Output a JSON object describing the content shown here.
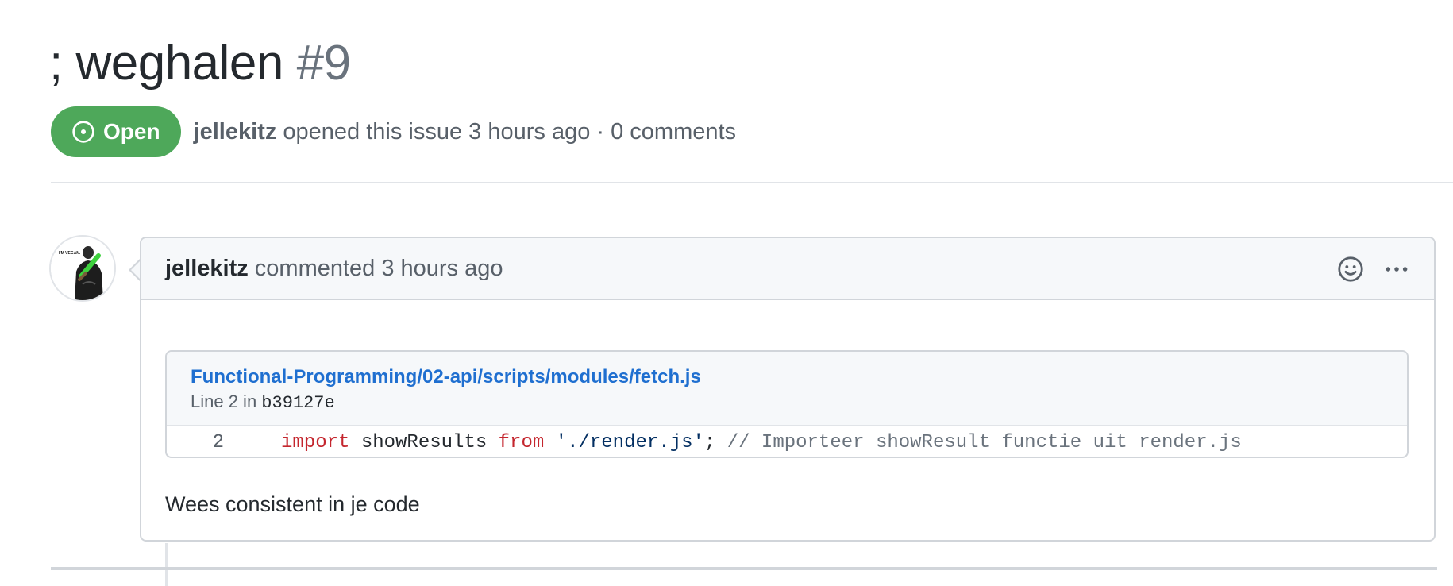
{
  "issue": {
    "title": "; weghalen",
    "number": "#9",
    "state_label": "Open",
    "author": "jellekitz",
    "opened_text": "opened this issue 3 hours ago · 0 comments"
  },
  "comment": {
    "author": "jellekitz",
    "action_text": "commented 3 hours ago",
    "body": "Wees consistent in je code",
    "avatar_text": "I'M VEGAN.",
    "actions": [
      "smiley-icon",
      "kebab-horizontal-icon"
    ]
  },
  "snippet": {
    "file_path": "Functional-Programming/02-api/scripts/modules/fetch.js",
    "line_prefix": "Line 2 in ",
    "commit": "b39127e",
    "line_number": "2",
    "code": {
      "kw1": "import",
      "ident": " showResults ",
      "kw2": "from",
      "space": " ",
      "str": "'./render.js'",
      "punct": ";",
      "comment": " // Importeer showResult functie uit render.js"
    }
  },
  "colors": {
    "open_badge": "#4ea85a",
    "link": "#1f6fd0",
    "keyword": "#c4262e",
    "string": "#032f62",
    "comment": "#6a737d"
  }
}
